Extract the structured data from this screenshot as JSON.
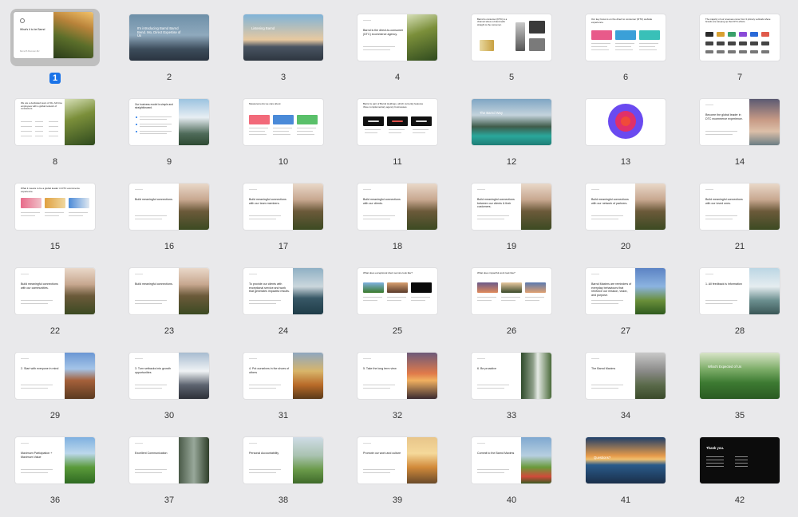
{
  "view": "slide-grid",
  "selected_slide": 1,
  "slides": [
    {
      "n": "1",
      "kind": "cover",
      "title": "What's it to be Barnd",
      "sub": "Barnd B Bwinster-Biz"
    },
    {
      "n": "2",
      "kind": "full",
      "title": "It's introducing Barnd Barnd Bend. Mo, Direct Expertise of Us",
      "theme": "mountain-blue"
    },
    {
      "n": "3",
      "kind": "full",
      "title": "Listening Barnd",
      "theme": "sunrise"
    },
    {
      "n": "4",
      "kind": "textimg",
      "title": "Barnd is the direct-to-consumer (DTC) ecommerce agency.",
      "theme": "forest"
    },
    {
      "n": "5",
      "kind": "products",
      "title": "Barnd to consumer (DTC) is a channel where a brand sells straight to the consumer."
    },
    {
      "n": "6",
      "kind": "cards3",
      "title": "Our key focus is on the direct to consumer (DTC) website experience."
    },
    {
      "n": "7",
      "kind": "logos",
      "title": "The majority of our revenues come from 3 primary verticals where brands are ramping up their DTC efforts."
    },
    {
      "n": "8",
      "kind": "table",
      "title": "We are a dedicated team of 30+ full time employees with a global network of contractors.",
      "theme": "forest"
    },
    {
      "n": "9",
      "kind": "bullets",
      "title": "Our business model is simple and straightforward.",
      "theme": "glacier"
    },
    {
      "n": "10",
      "kind": "cards3",
      "title": "Measurements we care about"
    },
    {
      "n": "11",
      "kind": "darkcards",
      "title": "Barnd is part of Barnd Holdings, which currently features three complementary agency businesses."
    },
    {
      "n": "12",
      "kind": "full",
      "title": "The Barnd Way",
      "theme": "lake"
    },
    {
      "n": "13",
      "kind": "rings",
      "title": ""
    },
    {
      "n": "14",
      "kind": "textimg",
      "title": "Become the global leader in DTC ecommerce experience.",
      "theme": "dusk"
    },
    {
      "n": "15",
      "kind": "imgs3",
      "title": "What it means to be a global leader in DTC ecommerce experience."
    },
    {
      "n": "16",
      "kind": "textimg",
      "title": "Build meaningful connections.",
      "theme": "hills"
    },
    {
      "n": "17",
      "kind": "textimg",
      "title": "Build meaningful connections with our team members.",
      "theme": "hills"
    },
    {
      "n": "18",
      "kind": "textimg",
      "title": "Build meaningful connections with our clients.",
      "theme": "hills"
    },
    {
      "n": "19",
      "kind": "textimg",
      "title": "Build meaningful connections between our clients & their customers.",
      "theme": "hills"
    },
    {
      "n": "20",
      "kind": "textimg",
      "title": "Build meaningful connections with our network of partners.",
      "theme": "hills"
    },
    {
      "n": "21",
      "kind": "textimg",
      "title": "Build meaningful connections with our loved ones.",
      "theme": "hills"
    },
    {
      "n": "22",
      "kind": "textimg",
      "title": "Build meaningful connections with our communities.",
      "theme": "hills"
    },
    {
      "n": "23",
      "kind": "textimg",
      "title": "Build meaningful connections.",
      "theme": "hills"
    },
    {
      "n": "24",
      "kind": "textimg",
      "title": "To provide our clients with exceptional service and work that generates impactful results.",
      "theme": "river"
    },
    {
      "n": "25",
      "kind": "imgs3",
      "title": "What does exceptional client service look like?"
    },
    {
      "n": "26",
      "kind": "imgs3",
      "title": "What does impactful work look like?"
    },
    {
      "n": "27",
      "kind": "textimg",
      "title": "Barnd Maxims are reminders of everyday behaviours that reinforce our mission, vision, and purpose.",
      "theme": "valley"
    },
    {
      "n": "28",
      "kind": "textimg",
      "title": "1. All feedback is information",
      "theme": "fjord"
    },
    {
      "n": "29",
      "kind": "textimg",
      "title": "2. Start with everyone in mind",
      "theme": "canyon"
    },
    {
      "n": "30",
      "kind": "textimg",
      "title": "3. Turn setbacks into growth opportunities",
      "theme": "peak"
    },
    {
      "n": "31",
      "kind": "textimg",
      "title": "4. Put ourselves in the shoes of others",
      "theme": "autumn"
    },
    {
      "n": "32",
      "kind": "textimg",
      "title": "5. Take the long term view",
      "theme": "sunset"
    },
    {
      "n": "33",
      "kind": "textimg",
      "title": "6. Be proactive",
      "theme": "waterfall"
    },
    {
      "n": "34",
      "kind": "textimg",
      "title": "The Barnd Maxims",
      "theme": "cliff"
    },
    {
      "n": "35",
      "kind": "full",
      "title": "What's Expected of Us",
      "theme": "meadow"
    },
    {
      "n": "36",
      "kind": "textimg",
      "title": "Maximum Participation + Maximum Value",
      "theme": "alps"
    },
    {
      "n": "37",
      "kind": "textimg",
      "title": "Excellent Communication",
      "theme": "gorge"
    },
    {
      "n": "38",
      "kind": "textimg",
      "title": "Personal Accountability",
      "theme": "greenhill"
    },
    {
      "n": "39",
      "kind": "textimg",
      "title": "Promote our work and culture",
      "theme": "sunglow"
    },
    {
      "n": "40",
      "kind": "textimg",
      "title": "Commit to the Barnd Maxims",
      "theme": "flowers"
    },
    {
      "n": "41",
      "kind": "full",
      "title": "Questions?",
      "theme": "ocean"
    },
    {
      "n": "42",
      "kind": "dark",
      "title": "Thank you."
    }
  ]
}
